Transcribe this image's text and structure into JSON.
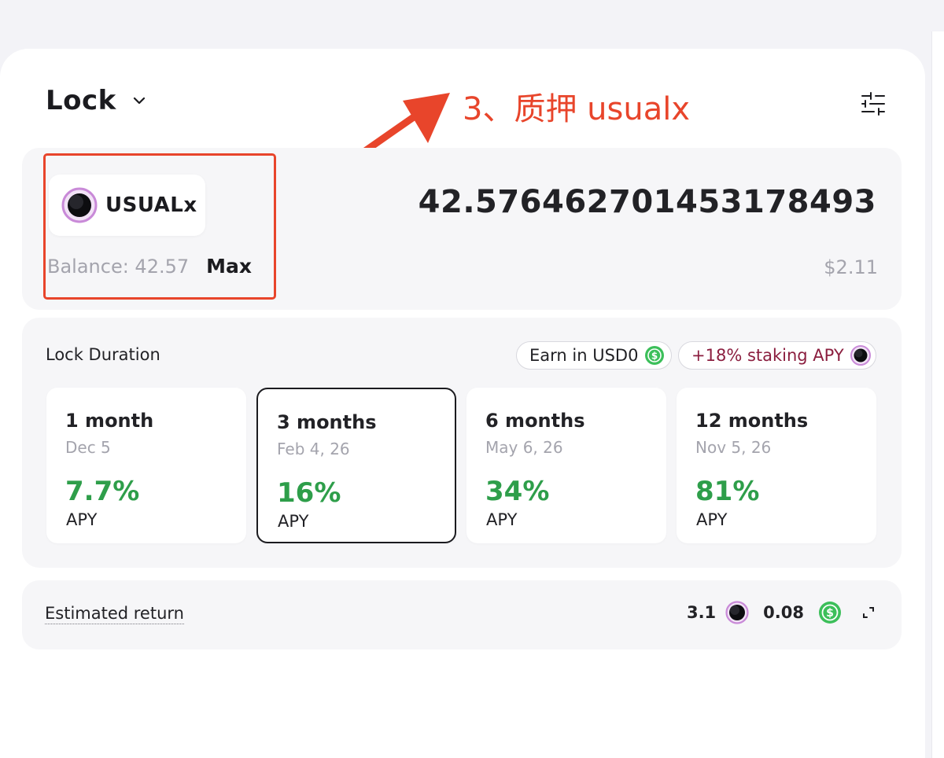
{
  "header": {
    "title": "Lock",
    "icons": {
      "dropdown": "chevron-down-icon",
      "settings": "sliders-icon"
    }
  },
  "annotation": {
    "text": "3、质押 usualx",
    "color": "#e8452b"
  },
  "input": {
    "token": "USUALx",
    "token_icon": "usualx-token-icon",
    "amount": "42.576462701453178493",
    "balance_label": "Balance: 42.57",
    "max_label": "Max",
    "usd_value": "$2.11"
  },
  "lock_duration": {
    "label": "Lock Duration",
    "earn_pill": "Earn in USD0",
    "staking_pill": "+18% staking APY",
    "selected_index": 1,
    "options": [
      {
        "title": "1 month",
        "date": "Dec 5",
        "apy": "7.7%",
        "apy_label": "APY"
      },
      {
        "title": "3 months",
        "date": "Feb 4, 26",
        "apy": "16%",
        "apy_label": "APY"
      },
      {
        "title": "6 months",
        "date": "May 6, 26",
        "apy": "34%",
        "apy_label": "APY"
      },
      {
        "title": "12 months",
        "date": "Nov 5, 26",
        "apy": "81%",
        "apy_label": "APY"
      }
    ]
  },
  "estimated_return": {
    "label": "Estimated return",
    "usualx_amount": "3.1",
    "usd0_amount": "0.08"
  },
  "colors": {
    "accent_green": "#2e9e4a",
    "staking_text": "#8b1e3f",
    "usd0_green": "#3cbf5a",
    "usualx_ring": "#c98ad8"
  }
}
